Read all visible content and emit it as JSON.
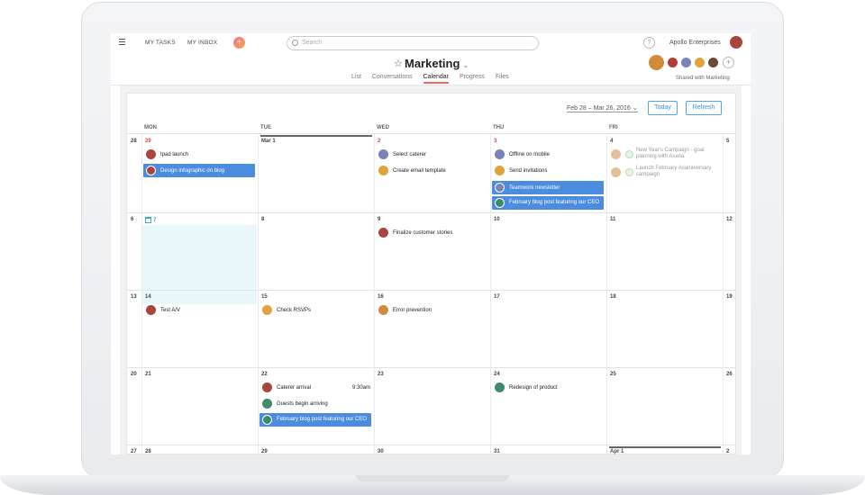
{
  "topbar": {
    "my_tasks": "MY TASKS",
    "my_inbox": "MY INBOX",
    "search_placeholder": "Search",
    "help": "?",
    "org": "Apollo Enterprises"
  },
  "project": {
    "title": "Marketing",
    "star": "☆",
    "chevron": "⌄",
    "shared": "Shared with Marketing",
    "tabs": [
      "List",
      "Conversations",
      "Calendar",
      "Progress",
      "Files"
    ],
    "active_tab": "Calendar"
  },
  "calendar": {
    "range": "Feb 28 – Mar 26, 2016 ⌄",
    "today_button": "Today",
    "refresh_button": "Refresh",
    "day_headers": [
      "MON",
      "TUE",
      "WED",
      "THU",
      "FRI"
    ],
    "weeks": [
      {
        "sun": "28",
        "days": [
          "29",
          "Mar 1",
          "2",
          "3",
          "4"
        ],
        "sat": "5"
      },
      {
        "sun": "6",
        "days": [
          "7",
          "8",
          "9",
          "10",
          "11"
        ],
        "sat": "12"
      },
      {
        "sun": "13",
        "days": [
          "14",
          "15",
          "16",
          "17",
          "18"
        ],
        "sat": "19"
      },
      {
        "sun": "20",
        "days": [
          "21",
          "22",
          "23",
          "24",
          "25"
        ],
        "sat": "26"
      },
      {
        "sun": "27",
        "days": [
          "28",
          "29",
          "30",
          "31",
          "Apr 1"
        ],
        "sat": "2"
      }
    ],
    "tasks": {
      "ipad": "Ipad launch",
      "infographic": "Design infographic on blog",
      "caterer": "Select caterer",
      "email_template": "Create email template",
      "offline": "Offline on mobile",
      "invitations": "Send invitations",
      "newsletter": "Teamwork newsletter",
      "feb_blog": "February blog post featuring our CEO",
      "new_year": "New Year's Campaign - goal planning with Asana",
      "launch_feb": "Launch February Asanaversary campaign",
      "finalize": "Finalize customer stories",
      "test_av": "Test A/V",
      "rsvps": "Check RSVPs",
      "error": "Error prevention",
      "caterer_arrival": "Caterer arrival",
      "caterer_time": "9:30am",
      "guests": "Guests begin arriving",
      "feb_blog2": "February blog post featuring our CEO",
      "redesign": "Redesign of product"
    }
  },
  "colors": {
    "accent": "#4b8cde",
    "today_bg": "#e9f6fa",
    "red_date": "#e0463b"
  }
}
